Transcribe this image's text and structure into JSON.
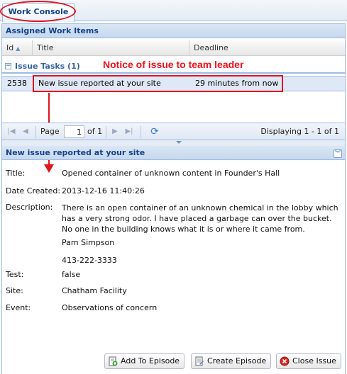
{
  "tabs": [
    {
      "label": "Work Console"
    }
  ],
  "work_items": {
    "title": "Assigned Work Items",
    "columns": {
      "id": "Id",
      "title": "Title",
      "deadline": "Deadline"
    },
    "group": {
      "label": "Issue Tasks (1)"
    },
    "rows": [
      {
        "id": "2538",
        "title": "New issue reported at your site",
        "deadline": "29 minutes from now"
      }
    ]
  },
  "annotation": {
    "text": "Notice of issue to team leader"
  },
  "pager": {
    "page_label": "Page",
    "current_page": "1",
    "of_label": "of 1",
    "displaying": "Displaying 1 - 1 of 1"
  },
  "detail": {
    "title": "New issue reported at your site",
    "fields": {
      "title_label": "Title:",
      "title_value": "Opened container of unknown content in Founder's Hall",
      "date_label": "Date Created:",
      "date_value": "2013-12-16 11:40:26",
      "description_label": "Description:",
      "description_p1": "There is an open container of an unknown chemical in the lobby which has a very strong odor. I have placed a garbage can over the bucket.  No one in the building knows what it is or where it came from.",
      "description_name": "Pam Simpson",
      "description_phone": "413-222-3333",
      "test_label": "Test:",
      "test_value": "false",
      "site_label": "Site:",
      "site_value": "Chatham Facility",
      "event_label": "Event:",
      "event_value": "Observations of concern"
    }
  },
  "buttons": {
    "add_to_episode": "Add To Episode",
    "create_episode": "Create Episode",
    "close_issue": "Close Issue"
  },
  "colors": {
    "annotation_red": "#e0141e",
    "header_blue": "#15428b",
    "selected_row": "#dfe8f6"
  }
}
